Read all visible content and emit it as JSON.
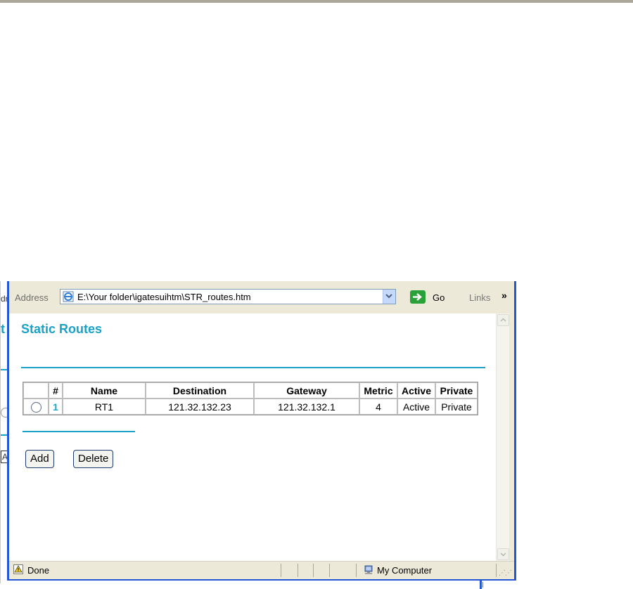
{
  "background_window": {
    "fragments": [
      "dr",
      "t",
      "A"
    ]
  },
  "browser": {
    "address_label": "Address",
    "url": "E:\\Your folder\\igatesuihtm\\STR_routes.htm",
    "go_label": "Go",
    "links_label": "Links",
    "overflow_glyph": "»"
  },
  "page": {
    "title": "Static Routes",
    "table": {
      "columns": [
        "",
        "#",
        "Name",
        "Destination",
        "Gateway",
        "Metric",
        "Active",
        "Private"
      ],
      "rows": [
        {
          "index": "1",
          "name": "RT1",
          "destination": "121.32.132.23",
          "gateway": "121.32.132.1",
          "metric": "4",
          "active": "Active",
          "private": "Private"
        }
      ]
    },
    "buttons": {
      "add": "Add",
      "delete": "Delete"
    }
  },
  "status": {
    "text": "Done",
    "zone": "My Computer"
  },
  "colors": {
    "accent": "#1aa2c8",
    "window_frame": "#2457d6",
    "chrome": "#ece9d8"
  },
  "icons": [
    "ie-page-icon",
    "dropdown-arrow-icon",
    "go-arrow-icon",
    "chevron-right-icon",
    "scroll-up-icon",
    "scroll-down-icon",
    "warning-page-icon",
    "my-computer-icon",
    "resize-grip-icon"
  ]
}
